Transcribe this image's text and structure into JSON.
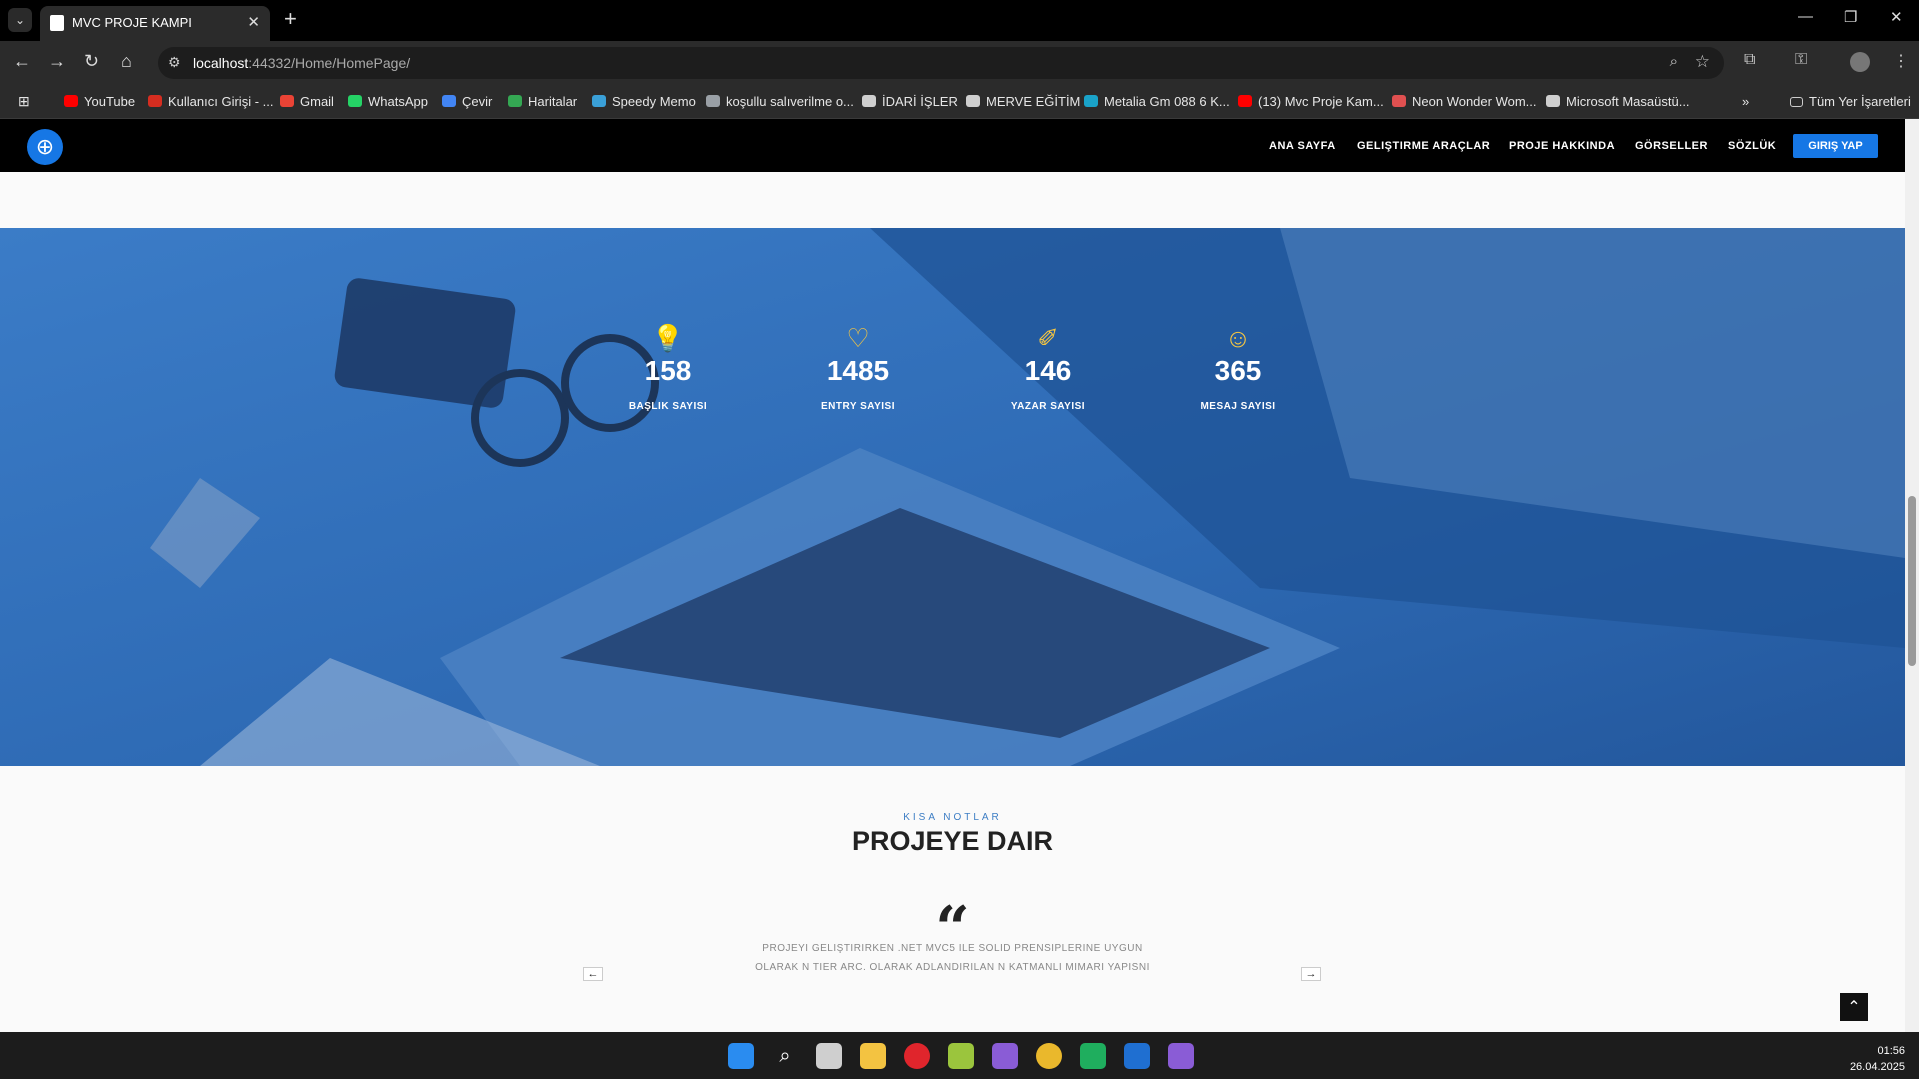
{
  "browser": {
    "tab_title": "MVC PROJE KAMPI",
    "url_host": "localhost",
    "url_rest": ":44332/Home/HomePage/",
    "bookmarks": [
      {
        "label": "YouTube",
        "color": "#ff0000"
      },
      {
        "label": "Kullanıcı Girişi - ...",
        "color": "#d62d20"
      },
      {
        "label": "Gmail",
        "color": "#ea4335"
      },
      {
        "label": "WhatsApp",
        "color": "#25d366"
      },
      {
        "label": "Çevir",
        "color": "#4285f4"
      },
      {
        "label": "Haritalar",
        "color": "#34a853"
      },
      {
        "label": "Speedy Memo",
        "color": "#3aa0d8"
      },
      {
        "label": "koşullu salıverilme o...",
        "color": "#9aa0a6"
      },
      {
        "label": "İDARİ İŞLER",
        "color": "#cfcfcf"
      },
      {
        "label": "MERVE EĞİTİM",
        "color": "#cfcfcf"
      },
      {
        "label": "Metalia Gm 088 6 K...",
        "color": "#1aa3c9"
      },
      {
        "label": "(13) Mvc Proje Kam...",
        "color": "#ff0000"
      },
      {
        "label": "Neon Wonder Wom...",
        "color": "#e05050"
      },
      {
        "label": "Microsoft Masaüstü...",
        "color": "#cfcfcf"
      }
    ],
    "all_bookmarks": "Tüm Yer İşaretleri"
  },
  "site": {
    "nav": [
      "ANA SAYFA",
      "GELIŞTIRME ARAÇLAR",
      "PROJE HAKKINDA",
      "GÖRSELLER",
      "SÖZLÜK"
    ],
    "login": "GIRIŞ YAP"
  },
  "stats": [
    {
      "icon": "lightbulb-icon",
      "value": "158",
      "label": "BAŞLIK SAYISI"
    },
    {
      "icon": "heart-icon",
      "value": "1485",
      "label": "ENTRY SAYISI"
    },
    {
      "icon": "magic-wand-icon",
      "value": "146",
      "label": "YAZAR SAYISI"
    },
    {
      "icon": "smiley-icon",
      "value": "365",
      "label": "MESAJ SAYISI"
    }
  ],
  "notes": {
    "kicker": "KISA NOTLAR",
    "title": "PROJEYE DAIR",
    "quote_line1": "PROJEYI GELIŞTIRIRKEN .NET MVC5 ILE SOLID PRENSIPLERINE UYGUN",
    "quote_line2": "OLARAK N TIER ARC. OLARAK ADLANDIRILAN N KATMANLI MIMARI YAPISNI"
  },
  "clock": {
    "time": "01:56",
    "date": "26.04.2025"
  },
  "colors": {
    "accent": "#1677e5",
    "hero_overlay": "#2f6fbb",
    "stat_icon": "#f4c542"
  }
}
